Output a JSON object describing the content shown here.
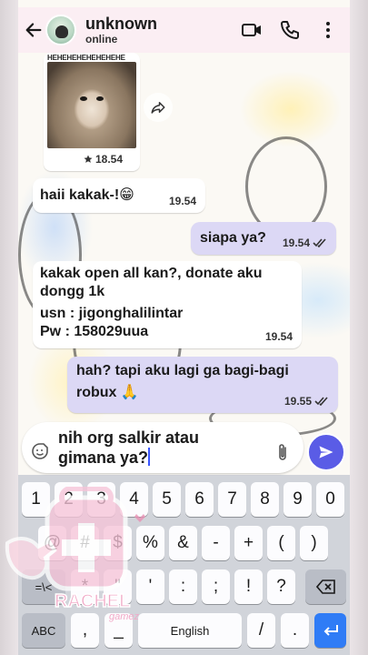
{
  "header": {
    "contact_name": "unknown",
    "status": "online"
  },
  "messages": {
    "image": {
      "caption_top": "HEHEHEHEHEHEHEHE",
      "time": "18.54"
    },
    "m1": {
      "text": "haii kakak-!😁",
      "time": "19.54"
    },
    "m2": {
      "text": "siapa ya?",
      "time": "19.54"
    },
    "m3": {
      "line1": "kakak open all kan?, donate aku",
      "line2": "dongg 1k",
      "line3": "usn : jigonghalilintar",
      "line4": "Pw : 158029uua",
      "time": "19.54"
    },
    "m4": {
      "line1": "hah? tapi aku lagi ga bagi-bagi",
      "line2": "robux 🙏",
      "time": "19.55"
    }
  },
  "composer": {
    "line1": "nih org salkir atau",
    "line2": "gimana ya?"
  },
  "keyboard": {
    "row1": [
      "1",
      "2",
      "3",
      "4",
      "5",
      "6",
      "7",
      "8",
      "9",
      "0"
    ],
    "row2": [
      "@",
      "#",
      "$",
      "%",
      "&",
      "-",
      "+",
      "(",
      ")"
    ],
    "row3": [
      "=\\<",
      "*",
      "\"",
      "'",
      ":",
      ";",
      "!",
      "?"
    ],
    "row4": {
      "abc": "ABC",
      "comma": ",",
      "underscore": "_",
      "space": "English",
      "slash": "/",
      "period": "."
    }
  },
  "sticker": {
    "text": "RACHEL",
    "subtext": "gamez"
  },
  "colors": {
    "accent": "#5a5ce6",
    "outgoing_bubble": "#dcd8f5",
    "header": "#fbeef3"
  }
}
